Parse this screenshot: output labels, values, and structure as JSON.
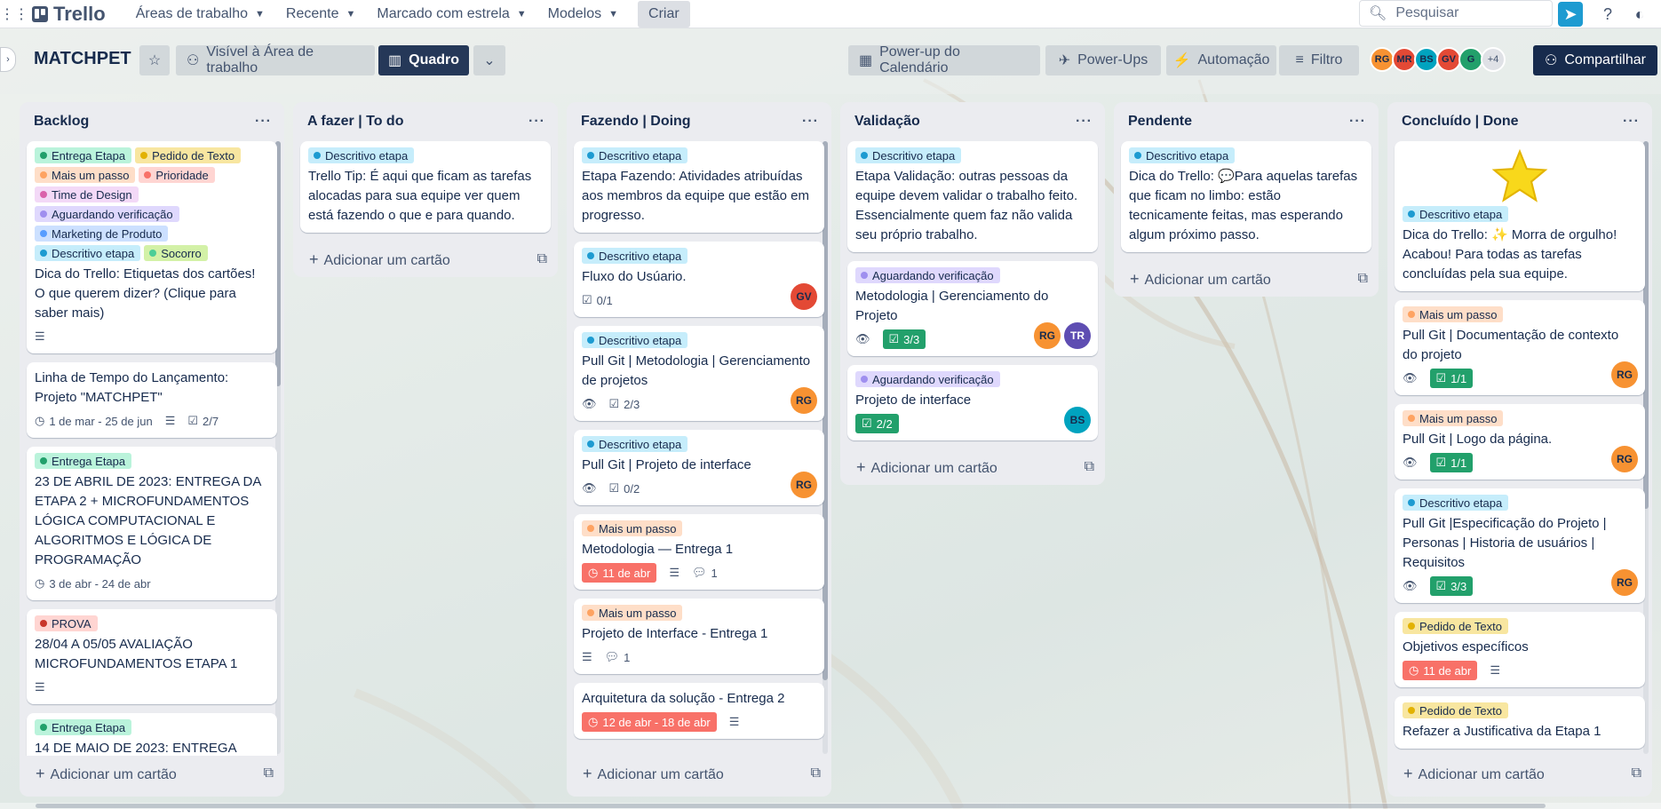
{
  "nav": {
    "brand": "Trello",
    "menus": [
      "Áreas de trabalho",
      "Recente",
      "Marcado com estrela",
      "Modelos"
    ],
    "create": "Criar",
    "search_placeholder": "Pesquisar"
  },
  "board": {
    "title": "MATCHPET",
    "visibility": "Visível à Área de trabalho",
    "view": "Quadro",
    "powerup_calendar": "Power-up do Calendário",
    "powerups": "Power-Ups",
    "automation": "Automação",
    "filter": "Filtro",
    "share": "Compartilhar",
    "members": [
      {
        "initials": "RG",
        "color": "#f79232"
      },
      {
        "initials": "MR",
        "color": "#e34935"
      },
      {
        "initials": "BS",
        "color": "#00a3bf"
      },
      {
        "initials": "GV",
        "color": "#e34935"
      },
      {
        "initials": "G",
        "color": "#22a06b"
      }
    ],
    "members_more": "+4"
  },
  "add_card_label": "Adicionar um cartão",
  "colors": {
    "label_green": "#4bce97",
    "label_yellow": "#f5cd47",
    "label_orange": "#fea362",
    "label_red": "#f87168",
    "label_purple": "#c084fc",
    "label_blue": "#579dff",
    "label_sky": "#6cc3e0",
    "label_lime": "#94c748"
  },
  "lists": [
    {
      "title": "Backlog",
      "cards": [
        {
          "labels": [
            "Entrega Etapa",
            "Pedido de Texto",
            "Mais um passo",
            "Prioridade",
            "Time de Design",
            "Aguardando verificação",
            "Marketing de Produto",
            "Descritivo etapa",
            "Socorro"
          ],
          "title": "Dica do Trello: Etiquetas dos cartões! O que querem dizer? (Clique para saber mais)"
        },
        {
          "title": "Linha de Tempo do Lançamento: Projeto \"MATCHPET\"",
          "dates": "1 de mar - 25 de jun",
          "checklist": "2/7"
        },
        {
          "labels": [
            "Entrega Etapa"
          ],
          "title": "23 DE ABRIL DE 2023: ENTREGA DA ETAPA 2 + MICROFUNDAMENTOS LÓGICA COMPUTACIONAL E ALGORITMOS E LÓGICA DE PROGRAMAÇÃO",
          "dates": "3 de abr - 24 de abr"
        },
        {
          "labels": [
            "PROVA"
          ],
          "title": "28/04 A 05/05 AVALIAÇÃO MICROFUNDAMENTOS ETAPA 1"
        },
        {
          "labels": [
            "Entrega Etapa"
          ],
          "title": "14 DE MAIO DE 2023: ENTREGA"
        }
      ]
    },
    {
      "title": "A fazer | To do",
      "cards": [
        {
          "labels": [
            "Descritivo etapa"
          ],
          "title": "Trello Tip: É aqui que ficam as tarefas alocadas para sua equipe ver quem está fazendo o que e para quando."
        }
      ]
    },
    {
      "title": "Fazendo | Doing",
      "cards": [
        {
          "labels": [
            "Descritivo etapa"
          ],
          "title": "Etapa Fazendo: Atividades atribuídas aos membros da equipe que estão em progresso."
        },
        {
          "labels": [
            "Descritivo etapa"
          ],
          "title": "Fluxo do Usúario.",
          "checklist": "0/1",
          "member": "GV"
        },
        {
          "labels": [
            "Descritivo etapa"
          ],
          "title": "Pull Git | Metodologia | Gerenciamento de projetos",
          "checklist": "2/3",
          "member": "RG"
        },
        {
          "labels": [
            "Descritivo etapa"
          ],
          "title": "Pull Git | Projeto de interface",
          "checklist": "0/2",
          "member": "RG"
        },
        {
          "labels": [
            "Mais um passo"
          ],
          "title": "Metodologia — Entrega 1",
          "due": "11 de abr",
          "comments": "1"
        },
        {
          "labels": [
            "Mais um passo"
          ],
          "title": "Projeto de Interface - Entrega 1",
          "comments": "1"
        },
        {
          "title": "Arquitetura da solução - Entrega 2",
          "due": "12 de abr - 18 de abr"
        }
      ]
    },
    {
      "title": "Validação",
      "cards": [
        {
          "labels": [
            "Descritivo etapa"
          ],
          "title": "Etapa Validação: outras pessoas da equipe devem validar o trabalho feito. Essencialmente quem faz não valida seu próprio trabalho."
        },
        {
          "labels": [
            "Aguardando verificação"
          ],
          "title": "Metodologia | Gerenciamento do Projeto",
          "checklist": "3/3",
          "members": [
            "RG",
            "TR"
          ]
        },
        {
          "labels": [
            "Aguardando verificação"
          ],
          "title": "Projeto de interface",
          "checklist": "2/2",
          "member": "BS"
        }
      ]
    },
    {
      "title": "Pendente",
      "cards": [
        {
          "labels": [
            "Descritivo etapa"
          ],
          "title": "Dica do Trello: 💬Para aquelas tarefas que ficam no limbo: estão tecnicamente feitas, mas esperando algum próximo passo."
        }
      ]
    },
    {
      "title": "Concluído | Done",
      "cards": [
        {
          "labels": [
            "Descritivo etapa"
          ],
          "title": "Dica do Trello: ✨ Morra de orgulho! Acabou! Para todas as tarefas concluídas pela sua equipe."
        },
        {
          "labels": [
            "Mais um passo"
          ],
          "title": "Pull Git | Documentação de contexto do projeto",
          "checklist": "1/1",
          "member": "RG"
        },
        {
          "labels": [
            "Mais um passo"
          ],
          "title": "Pull Git | Logo da página.",
          "checklist": "1/1",
          "member": "RG"
        },
        {
          "labels": [
            "Descritivo etapa"
          ],
          "title": "Pull Git |Especificação do Projeto | Personas | Historia de usuários | Requisitos",
          "checklist": "3/3",
          "member": "RG"
        },
        {
          "labels": [
            "Pedido de Texto"
          ],
          "title": "Objetivos específicos",
          "due": "11 de abr"
        },
        {
          "labels": [
            "Pedido de Texto"
          ],
          "title": "Refazer a Justificativa da Etapa 1"
        }
      ]
    }
  ]
}
